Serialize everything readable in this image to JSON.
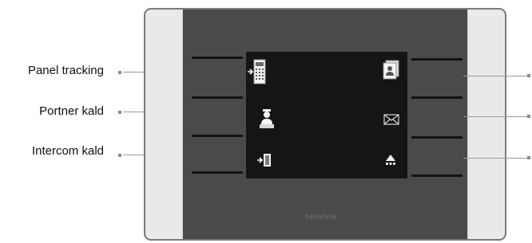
{
  "labels": {
    "left_top": "Panel tracking",
    "left_middle": "Portner kald",
    "left_bottom": "Intercom kald"
  },
  "device": {
    "brand": "beoview"
  },
  "icons": {
    "left": [
      "keypad-panel-icon",
      "porter-icon",
      "door-entry-icon"
    ],
    "right": [
      "address-book-icon",
      "envelope-icon",
      "bell-icon"
    ]
  },
  "colors": {
    "device_body": "#4a4a4a",
    "screen": "#151515",
    "side_panels": "#e9e9e9",
    "frame": "#7a7a7a"
  }
}
